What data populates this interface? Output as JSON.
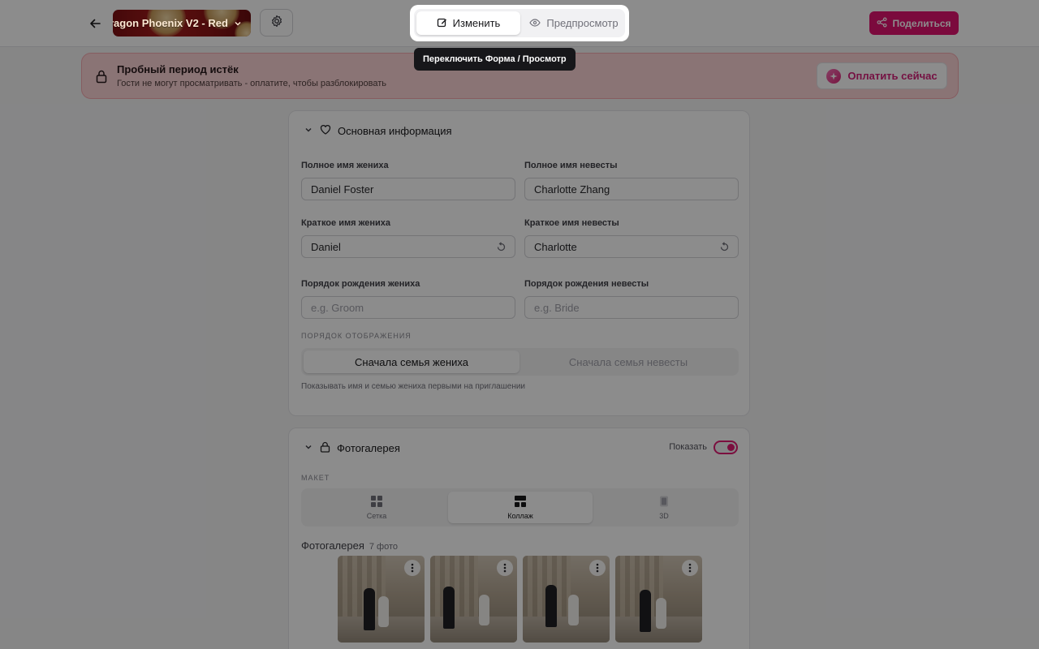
{
  "header": {
    "template_name": "ragon Phoenix V2 - Red",
    "share_label": "Поделиться"
  },
  "mode_switch": {
    "edit_label": "Изменить",
    "preview_label": "Предпросмотр",
    "tooltip": "Переключить Форма / Просмотр"
  },
  "banner": {
    "title": "Пробный период истёк",
    "subtitle": "Гости не могут просматривать - оплатите, чтобы разблокировать",
    "pay_label": "Оплатить сейчас"
  },
  "basic_info": {
    "title": "Основная информация",
    "groom_full_label": "Полное имя жениха",
    "groom_full_value": "Daniel Foster",
    "bride_full_label": "Полное имя невесты",
    "bride_full_value": "Charlotte Zhang",
    "groom_short_label": "Краткое имя жениха",
    "groom_short_value": "Daniel",
    "bride_short_label": "Краткое имя невесты",
    "bride_short_value": "Charlotte",
    "groom_order_label": "Порядок рождения жениха",
    "groom_order_placeholder": "e.g. Groom",
    "bride_order_label": "Порядок рождения невесты",
    "bride_order_placeholder": "e.g. Bride",
    "display_order_caption": "ПОРЯДОК ОТОБРАЖЕНИЯ",
    "groom_first_label": "Сначала семья жениха",
    "bride_first_label": "Сначала семья невесты",
    "hint": "Показывать имя и семью жениха первыми на приглашении"
  },
  "gallery": {
    "title": "Фотогалерея",
    "show_label": "Показать",
    "show_enabled": true,
    "layout_caption": "МАКЕТ",
    "layout_grid": "Сетка",
    "layout_collage": "Коллаж",
    "layout_3d": "3D",
    "list_title": "Фотогалерея",
    "count": "7 фото"
  },
  "colors": {
    "brand": "#e1136f",
    "banner_bg": "#fbd3d6",
    "overlay": "rgba(0,0,0,0.45)"
  }
}
